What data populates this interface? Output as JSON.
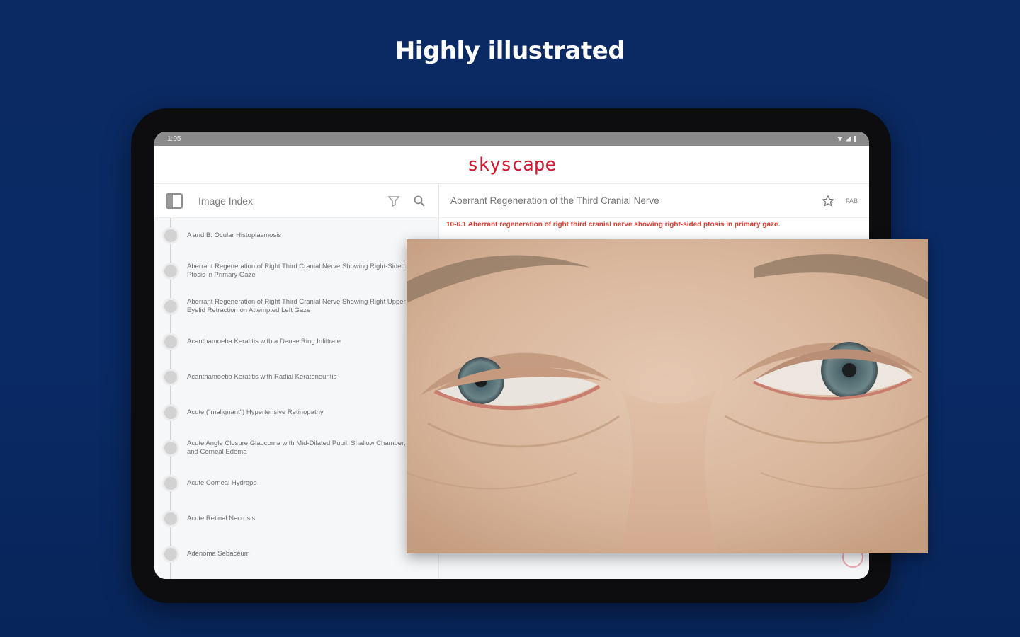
{
  "headline": "Highly illustrated",
  "status": {
    "time": "1:05"
  },
  "app": {
    "logo": "skyscape"
  },
  "left_pane": {
    "title": "Image Index",
    "items": [
      "A and B. Ocular Histoplasmosis",
      "Aberrant Regeneration of Right Third Cranial Nerve Showing Right-Sided Ptosis in Primary Gaze",
      "Aberrant Regeneration of Right Third Cranial Nerve Showing Right Upper Eyelid Retraction on Attempted Left Gaze",
      "Acanthamoeba Keratitis with a Dense Ring Infiltrate",
      "Acanthamoeba Keratitis with Radial Keratoneuritis",
      "Acute (\"malignant\") Hypertensive Retinopathy",
      "Acute Angle Closure Glaucoma with Mid-Dilated Pupil, Shallow Chamber, and Corneal Edema",
      "Acute Corneal Hydrops",
      "Acute Retinal Necrosis",
      "Adenoma Sebaceum"
    ]
  },
  "right_pane": {
    "title": "Aberrant Regeneration of the Third Cranial Nerve",
    "fab_label": "FAB",
    "caption": "10-6.1 Aberrant regeneration of right third cranial nerve showing right-sided ptosis in primary gaze."
  },
  "icons": {
    "panel": "sidebar-panel-icon",
    "filter": "filter-icon",
    "search": "search-icon",
    "star": "star-icon",
    "wifi": "wifi-icon",
    "signal": "signal-icon",
    "battery": "battery-icon"
  },
  "colors": {
    "background": "#0a2a66",
    "brand": "#d3172e",
    "caption": "#e2392e"
  }
}
